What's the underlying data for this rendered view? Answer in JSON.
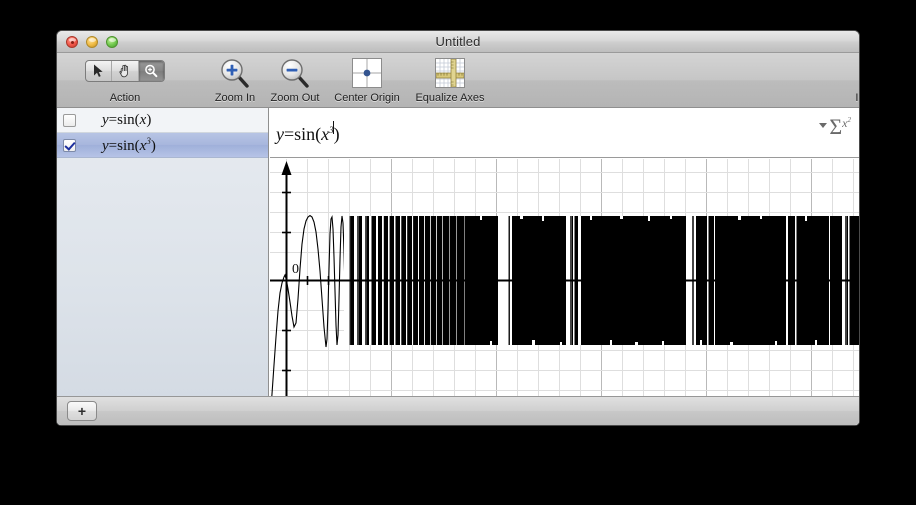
{
  "window": {
    "title": "Untitled",
    "controls": {
      "close": "close-button",
      "minimize": "minimize-button",
      "maximize": "maximize-button"
    }
  },
  "toolbar": {
    "items": [
      {
        "id": "action",
        "label": "Action",
        "icon": "arrow-hand-magnifier-segmented"
      },
      {
        "id": "zoom-in",
        "label": "Zoom In",
        "icon": "magnifier-plus-icon"
      },
      {
        "id": "zoom-out",
        "label": "Zoom Out",
        "icon": "magnifier-minus-icon"
      },
      {
        "id": "center-origin",
        "label": "Center Origin",
        "icon": "center-origin-icon"
      },
      {
        "id": "equalize-axes",
        "label": "Equalize Axes",
        "icon": "equalize-axes-icon"
      },
      {
        "id": "inspector",
        "label": "Inspector",
        "icon": "info-circle-icon"
      }
    ],
    "action_segments": [
      {
        "id": "select",
        "icon": "arrow-cursor-icon",
        "selected": false
      },
      {
        "id": "pan",
        "icon": "hand-icon",
        "selected": false
      },
      {
        "id": "zoom",
        "icon": "magnifier-icon",
        "selected": true
      }
    ]
  },
  "sidebar": {
    "equations": [
      {
        "label_html": "y=sin(x)",
        "y": "y",
        "fn": "=sin(",
        "var": "x",
        "exp": "",
        "close": ")",
        "checked": false,
        "selected": false
      },
      {
        "label_html": "y=sin(x^3)",
        "y": "y",
        "fn": "=sin(",
        "var": "x",
        "exp": "3",
        "close": ")",
        "checked": true,
        "selected": true
      }
    ],
    "add_button_label": "+"
  },
  "formula_bar": {
    "y": "y",
    "fn": "=sin(",
    "var": "x",
    "exp": "3",
    "close": ")",
    "full_text": "y=sin(x^3)",
    "has_caret": true,
    "palette": {
      "sigma": "Σ",
      "superscript": "x",
      "dropdown": "chevron-down-icon"
    }
  },
  "chart_data": {
    "type": "line",
    "title": "",
    "expression": "y = sin(x^3)",
    "xlabel": "",
    "ylabel": "",
    "origin_label": "0",
    "xlim": [
      -0.9,
      27.0
    ],
    "ylim": [
      -5.05,
      5.05
    ],
    "grid": true,
    "minor_gridline_spacing_x": 0.7,
    "major_gridline_spacing_x": 3.5,
    "minor_gridline_spacing_y": 0.72,
    "axis_color": "#000000",
    "grid_color": "#d8d8d8",
    "major_grid_color": "#b4b4b4",
    "curve_color": "#000000",
    "notes": "Dense aliased oscillation of sin(x^3): visible individual waves near x=0 collapsing into a solid black band of amplitude 1 for x greater than about 4."
  },
  "colors": {
    "accent_blue": "#4a59bd",
    "selection_blue": "#a7b6dd",
    "sidebar_bg": "#dde3ea",
    "toolbar_bg": "#c6c6c6",
    "titlebar_bg": "#d6d6d6",
    "desktop_bg": "#000000"
  }
}
